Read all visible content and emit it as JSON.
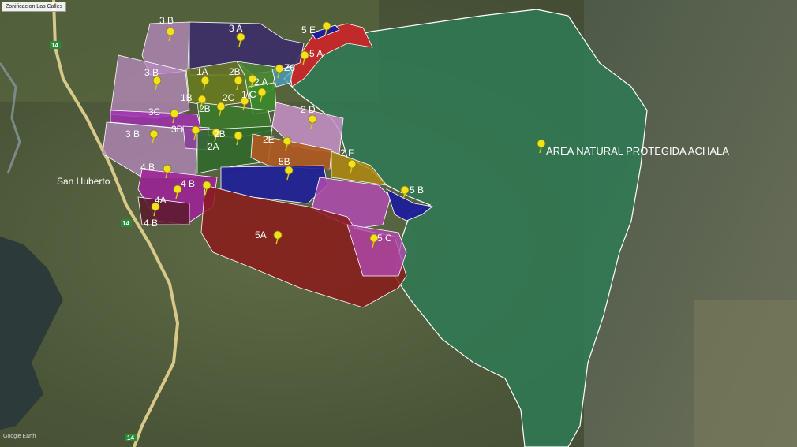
{
  "title": "Zonificacion Las Calles",
  "watermark": "Google Earth",
  "place_label": "San Huberto",
  "route_label": "14",
  "protected_area_label": "AREA NATURAL PROTEGIDA ACHALA",
  "zones": {
    "z3b_top": "3 B",
    "z3a": "3 A",
    "z5e": "5 E",
    "z5a_top": "5 A",
    "z3b_mid": "3 B",
    "z1a": "1A",
    "z2b_a": "2B",
    "z2a_small": "2 A",
    "z6": "Z6",
    "z1b": "1B",
    "z2c": "2C",
    "z1c": "1 C",
    "z2b_b": "2B",
    "z3c": "3C",
    "z2d": "2 D",
    "z3b_low": "3 B",
    "z3d": "3D",
    "z2b_c": "2B",
    "z2a": "2A",
    "z2e": "2E",
    "z2f": "2 F",
    "z5b": "5B",
    "z4b_a": "4 B",
    "z4b_b": "4 B",
    "z5b_east": "5 B",
    "z4a": "4A",
    "z4b_c": "4 B",
    "z5a": "5A",
    "z5c": "5 C"
  },
  "colors": {
    "protected": "#2f7a55",
    "zone5a": "#8b1a1a",
    "zone5b": "#1e1e9a",
    "zone5c": "#b04ab0",
    "zone3b": "#b88ac0",
    "zone3a": "#3a2a6a",
    "zone2": "#3a7a2a",
    "zone4": "#a0209a",
    "zone2d": "#c890c8",
    "zone2e": "#b05a20",
    "zone2f": "#b08a10",
    "pin": "#f2e21a"
  }
}
